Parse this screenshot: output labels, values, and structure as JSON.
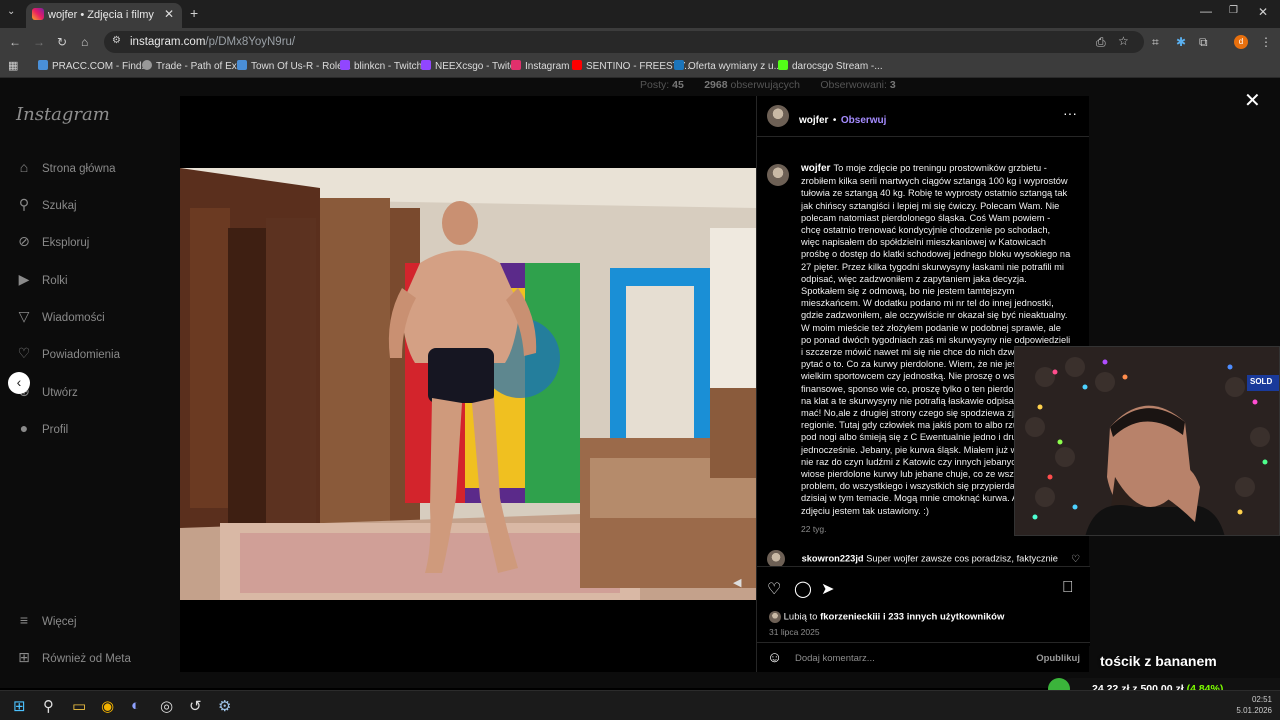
{
  "browser": {
    "tab_title": "wojfer • Zdjęcia i filmy Instagra",
    "url_host": "instagram.com",
    "url_path": "/p/DMx8YoyN9ru/",
    "bookmarks": [
      "PRACC.COM - Find...",
      "Trade - Path of Exile",
      "Town Of Us-R - Role...",
      "blinkcn - Twitch",
      "NEEXcsgo - Twitch",
      "Instagram",
      "SENTINO - FREESTY...",
      "Oferta wymiany z u...",
      "darocsgo Stream -..."
    ],
    "bookmark_colors": [
      "#4a90d9",
      "#999999",
      "#4a8ed6",
      "#9146ff",
      "#9146ff",
      "#e1306c",
      "#ff0000",
      "#1b75bb",
      "#53fc18"
    ]
  },
  "background_profile": {
    "posts_label": "Posty:",
    "posts_value": "45",
    "followers_value": "2968",
    "followers_label": "obserwujących",
    "following_label": "Obserwowani:",
    "following_value": "3"
  },
  "sidebar": {
    "logo": "Instagram",
    "items": [
      {
        "label": "Strona główna",
        "icon": "home-icon"
      },
      {
        "label": "Szukaj",
        "icon": "search-icon"
      },
      {
        "label": "Eksploruj",
        "icon": "compass-icon"
      },
      {
        "label": "Rolki",
        "icon": "reels-icon"
      },
      {
        "label": "Wiadomości",
        "icon": "messages-icon"
      },
      {
        "label": "Powiadomienia",
        "icon": "heart-icon"
      },
      {
        "label": "Utwórz",
        "icon": "plus-icon"
      },
      {
        "label": "Profil",
        "icon": "avatar-icon"
      }
    ],
    "more": "Więcej",
    "meta": "Również od Meta"
  },
  "post": {
    "username": "wojfer",
    "separator": "•",
    "follow_label": "Obserwuj",
    "caption": "To moje zdjęcie po treningu prostowników grzbietu - zrobiłem kilka serii martwych ciągów sztangą 100 kg i wyprostów tułowia ze sztangą 40 kg. Robię te wyprosty ostatnio sztangą tak jak chińscy sztangiści i lepiej mi się ćwiczy. Polecam Wam. Nie polecam natomiast pierdolonego śląska. Coś Wam powiem - chcę ostatnio trenować kondycyjnie chodzenie po schodach, więc napisałem do spółdzielni mieszkaniowej w Katowicach prośbę o dostęp do klatki schodowej jednego bloku wysokiego na 27 pięter. Przez kilka tygodni skurwysyny łaskami nie potrafili mi odpisać, więc zadzwoniłem z zapytaniem jaka decyzja. Spotkałem się z odmową, bo nie jestem tamtejszym mieszkańcem. W dodatku podano mi nr tel do innej jednostki, gdzie zadzwoniłem, ale oczywiście nr okazał się być nieaktualny. W moim mieście też złożyłem podanie w podobnej sprawie, ale po ponad dwóch tygodniach zaś mi skurwysyny nie odpowiedzieli i szczerze mówić nawet mi się nie chce do nich dzwonić czy iść i pytać o to. Co za kurwy pierdolone. Wiem, że nie jestem żadnym wielkim sportowcem czy jednostką. Nie proszę o wsparcie finansowe, sponso wie co, proszę tylko o ten pierdolony dostęp na klat a te skurwysyny nie potrafią łaskawie odpisać mi na ich mać! No,ale z drugiej strony czego się spodziewa zjebanym regionie. Tutaj gdy człowiek ma jakiś pom to albo rzucają Ci kłody pod nogi albo śmieją się z C Ewentualnie jedno i drugie jednocześnie. Jebany, pie kurwa śląsk. Miałem już w przeszłości nie raz do czyn ludźmi z Katowic czy innych jebanych śląskich wiose pierdolone kurwy lub jebane chuje, co ze wszystkim problem, do wszystkiego i wszystkich się przypierda I tyle na dzisiaj w tym temacie. Mogą mnie cmoknąć kurwa. Akurat na zdjęciu jestem tak ustawiony. :)",
    "caption_age": "22 tyg.",
    "comment_user": "skowron223jd",
    "comment_text": "Super wojfer zawsze cos poradzisz, faktycznie",
    "likes_prefix": "Lubią to",
    "likes_user": "fkorzenieckiii",
    "likes_suffix": "i 233 innych użytkowników",
    "date": "31 lipca 2025",
    "comment_placeholder": "Dodaj komentarz...",
    "publish_label": "Opublikuj"
  },
  "overlay": {
    "donation_title": "tościk z bananem",
    "donation_progress": "24,22 zł z 500,00 zł",
    "donation_percent": "(4.84%)",
    "cam_sign": "SOLD"
  },
  "taskbar": {
    "time": "02:51",
    "date": "5.01.2026"
  }
}
